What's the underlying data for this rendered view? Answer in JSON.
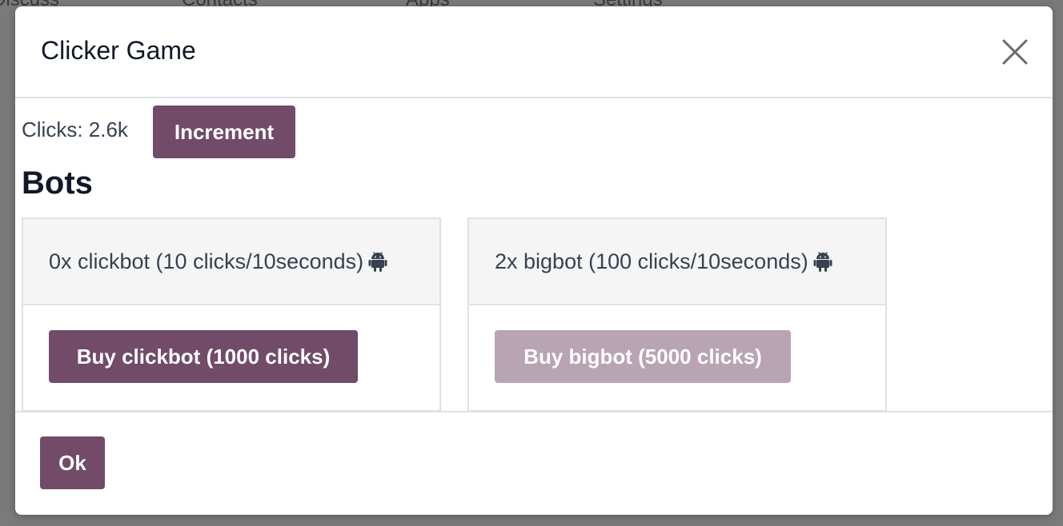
{
  "background_nav": {
    "items": [
      "Discuss",
      "Contacts",
      "Apps",
      "Settings"
    ]
  },
  "modal": {
    "title": "Clicker Game",
    "close_icon": "close-icon"
  },
  "counter": {
    "clicks_text": "Clicks: 2.6k",
    "increment_label": "Increment"
  },
  "bots": {
    "heading": "Bots",
    "items": [
      {
        "description": "0x clickbot (10 clicks/10seconds)",
        "icon": "android-icon",
        "buy_label": "Buy clickbot (1000 clicks)",
        "enabled": true
      },
      {
        "description": "2x bigbot (100 clicks/10seconds)",
        "icon": "android-icon",
        "buy_label": "Buy bigbot (5000 clicks)",
        "enabled": false
      }
    ]
  },
  "footer": {
    "ok_label": "Ok"
  },
  "colors": {
    "primary": "#714b67",
    "primary_disabled": "#b8a4b3",
    "card_header_bg": "#f5f5f5",
    "border": "#dee2e6"
  }
}
